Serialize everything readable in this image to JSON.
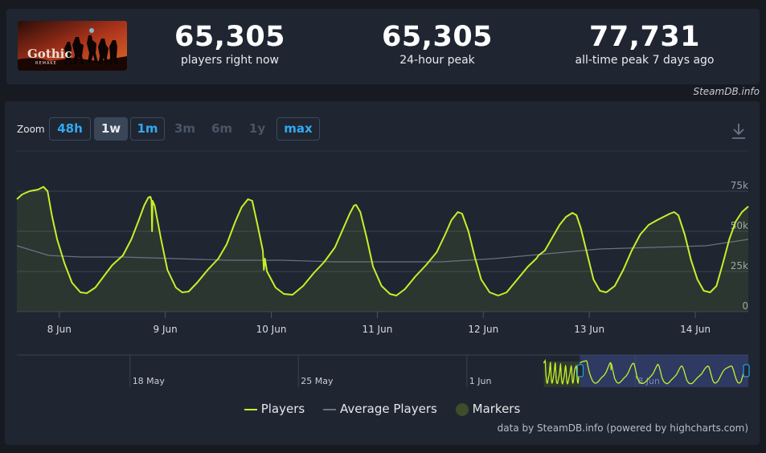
{
  "stats": [
    {
      "value": "65,305",
      "label": "players right now"
    },
    {
      "value": "65,305",
      "label": "24-hour peak"
    },
    {
      "value": "77,731",
      "label": "all-time peak 7 days ago"
    }
  ],
  "credit": "SteamDB.info",
  "zoom": {
    "label": "Zoom",
    "buttons": [
      {
        "label": "48h",
        "state": "on"
      },
      {
        "label": "1w",
        "state": "sel"
      },
      {
        "label": "1m",
        "state": "on"
      },
      {
        "label": "3m",
        "state": "off"
      },
      {
        "label": "6m",
        "state": "off"
      },
      {
        "label": "1y",
        "state": "off"
      },
      {
        "label": "max",
        "state": "on"
      }
    ]
  },
  "footer": "data by SteamDB.info (powered by highcharts.com)",
  "colors": {
    "players": "#c5f02a",
    "average": "#6b7280",
    "grid": "#3a4250",
    "navigator": "#3a4a8a"
  },
  "chart_data": {
    "type": "line",
    "x_range": [
      "7 Jun 15:00",
      "14 Jun 12:00"
    ],
    "ylim": [
      0,
      100000
    ],
    "y_ticks": [
      {
        "v": 0,
        "label": "0"
      },
      {
        "v": 25000,
        "label": "25k"
      },
      {
        "v": 50000,
        "label": "50k"
      },
      {
        "v": 75000,
        "label": "75k"
      }
    ],
    "x_ticks": [
      {
        "d": 0.4,
        "label": "8 Jun"
      },
      {
        "d": 1.4,
        "label": "9 Jun"
      },
      {
        "d": 2.4,
        "label": "10 Jun"
      },
      {
        "d": 3.4,
        "label": "11 Jun"
      },
      {
        "d": 4.4,
        "label": "12 Jun"
      },
      {
        "d": 5.4,
        "label": "13 Jun"
      },
      {
        "d": 6.4,
        "label": "14 Jun"
      }
    ],
    "series": [
      {
        "name": "Players",
        "points": [
          [
            0,
            70000
          ],
          [
            0.05,
            73000
          ],
          [
            0.12,
            75000
          ],
          [
            0.2,
            76000
          ],
          [
            0.25,
            77700
          ],
          [
            0.29,
            75000
          ],
          [
            0.33,
            60000
          ],
          [
            0.38,
            45000
          ],
          [
            0.45,
            30000
          ],
          [
            0.52,
            18000
          ],
          [
            0.6,
            12000
          ],
          [
            0.66,
            11500
          ],
          [
            0.74,
            15000
          ],
          [
            0.82,
            22000
          ],
          [
            0.9,
            29000
          ],
          [
            1.0,
            35000
          ],
          [
            1.08,
            45000
          ],
          [
            1.15,
            57000
          ],
          [
            1.2,
            66000
          ],
          [
            1.24,
            71000
          ],
          [
            1.26,
            71500
          ],
          [
            1.27,
            69000
          ],
          [
            1.275,
            50000
          ],
          [
            1.28,
            69000
          ],
          [
            1.3,
            66000
          ],
          [
            1.36,
            45000
          ],
          [
            1.42,
            26000
          ],
          [
            1.5,
            15000
          ],
          [
            1.56,
            12000
          ],
          [
            1.62,
            12500
          ],
          [
            1.7,
            18000
          ],
          [
            1.8,
            26000
          ],
          [
            1.9,
            33000
          ],
          [
            1.98,
            42000
          ],
          [
            2.06,
            56000
          ],
          [
            2.12,
            65000
          ],
          [
            2.18,
            70000
          ],
          [
            2.22,
            69000
          ],
          [
            2.27,
            54000
          ],
          [
            2.32,
            38000
          ],
          [
            2.33,
            26000
          ],
          [
            2.34,
            33000
          ],
          [
            2.36,
            25000
          ],
          [
            2.44,
            15000
          ],
          [
            2.52,
            11000
          ],
          [
            2.6,
            10500
          ],
          [
            2.7,
            16000
          ],
          [
            2.8,
            24000
          ],
          [
            2.9,
            31000
          ],
          [
            3.0,
            40000
          ],
          [
            3.08,
            52000
          ],
          [
            3.14,
            61000
          ],
          [
            3.18,
            66000
          ],
          [
            3.2,
            66500
          ],
          [
            3.24,
            62000
          ],
          [
            3.3,
            46000
          ],
          [
            3.36,
            28000
          ],
          [
            3.44,
            16000
          ],
          [
            3.52,
            11000
          ],
          [
            3.58,
            10000
          ],
          [
            3.66,
            14000
          ],
          [
            3.76,
            22000
          ],
          [
            3.86,
            29000
          ],
          [
            3.96,
            37000
          ],
          [
            4.04,
            48000
          ],
          [
            4.1,
            57000
          ],
          [
            4.16,
            62000
          ],
          [
            4.2,
            61000
          ],
          [
            4.26,
            50000
          ],
          [
            4.32,
            34000
          ],
          [
            4.38,
            20000
          ],
          [
            4.46,
            12000
          ],
          [
            4.54,
            10000
          ],
          [
            4.62,
            12000
          ],
          [
            4.72,
            20000
          ],
          [
            4.82,
            28000
          ],
          [
            4.9,
            33000
          ],
          [
            4.92,
            35000
          ],
          [
            4.98,
            38000
          ],
          [
            5.05,
            46000
          ],
          [
            5.12,
            54000
          ],
          [
            5.18,
            59000
          ],
          [
            5.24,
            61500
          ],
          [
            5.28,
            60000
          ],
          [
            5.32,
            52000
          ],
          [
            5.38,
            36000
          ],
          [
            5.44,
            20000
          ],
          [
            5.5,
            13000
          ],
          [
            5.56,
            12000
          ],
          [
            5.64,
            16000
          ],
          [
            5.72,
            26000
          ],
          [
            5.8,
            38000
          ],
          [
            5.88,
            48000
          ],
          [
            5.96,
            54000
          ],
          [
            6.04,
            57000
          ],
          [
            6.1,
            59000
          ],
          [
            6.16,
            61000
          ],
          [
            6.2,
            62000
          ],
          [
            6.24,
            60000
          ],
          [
            6.3,
            48000
          ],
          [
            6.36,
            32000
          ],
          [
            6.42,
            20000
          ],
          [
            6.48,
            13000
          ],
          [
            6.54,
            12000
          ],
          [
            6.6,
            16000
          ],
          [
            6.66,
            30000
          ],
          [
            6.72,
            45000
          ],
          [
            6.78,
            56000
          ],
          [
            6.84,
            62000
          ],
          [
            6.9,
            65500
          ]
        ]
      },
      {
        "name": "Average Players",
        "points": [
          [
            0,
            41000
          ],
          [
            0.3,
            35000
          ],
          [
            0.6,
            34000
          ],
          [
            1.0,
            34000
          ],
          [
            1.5,
            33000
          ],
          [
            2.0,
            32000
          ],
          [
            2.5,
            32000
          ],
          [
            3.0,
            31000
          ],
          [
            3.5,
            31000
          ],
          [
            4.0,
            31000
          ],
          [
            4.5,
            33000
          ],
          [
            5.0,
            36000
          ],
          [
            5.5,
            39000
          ],
          [
            6.0,
            40000
          ],
          [
            6.5,
            41000
          ],
          [
            6.9,
            45000
          ]
        ]
      }
    ],
    "navigator": {
      "labels": [
        {
          "d": -18.8,
          "label": "18 May"
        },
        {
          "d": -11.8,
          "label": "25 May"
        },
        {
          "d": -4.8,
          "label": "1 Jun"
        },
        {
          "d": 2.2,
          "label": "8 Jun"
        }
      ]
    }
  }
}
